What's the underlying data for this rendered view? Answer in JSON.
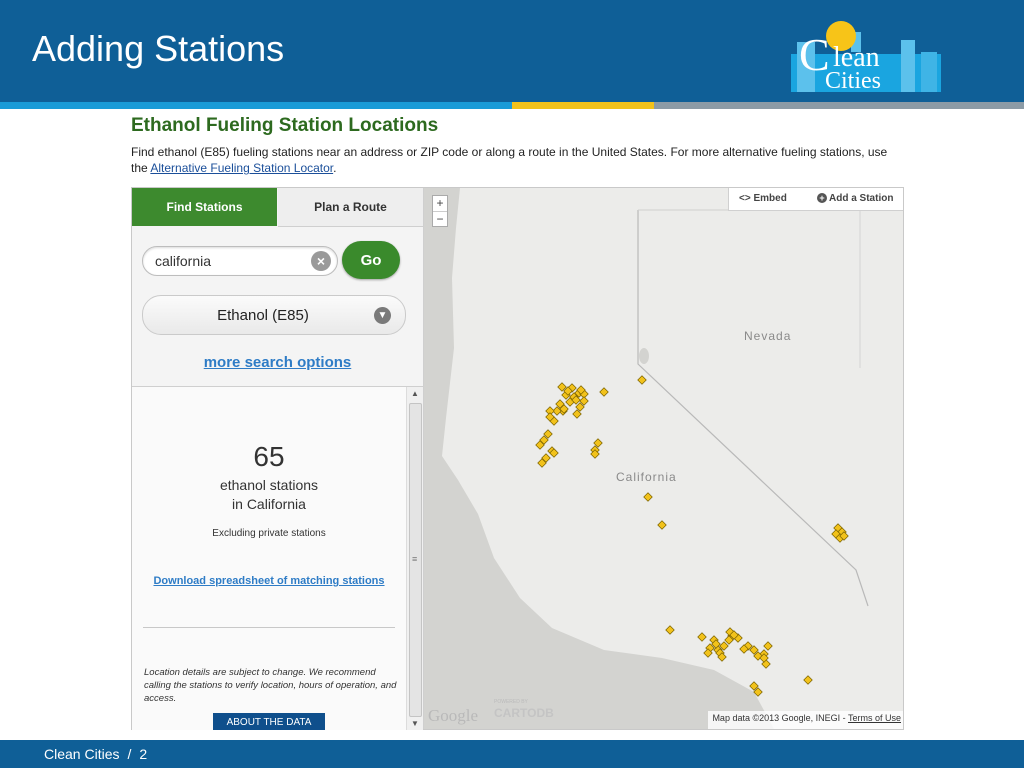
{
  "slide": {
    "title": "Adding Stations",
    "footer_text": "Clean Cities",
    "footer_sep": "/",
    "page_number": "2",
    "colors": {
      "header": "#0f5f97",
      "accent_blue": "#1a9bd7",
      "accent_yellow": "#f2c21b",
      "accent_gray": "#8c9ba6"
    }
  },
  "logo": {
    "line1": "lean",
    "initial": "C",
    "line2": "Cities"
  },
  "page": {
    "heading": "Ethanol Fueling Station Locations",
    "intro_text": "Find ethanol (E85) fueling stations near an address or ZIP code or along a route in the United States. For more alternative fueling stations, use the ",
    "intro_link": "Alternative Fueling Station Locator",
    "intro_end": "."
  },
  "panel": {
    "tabs": [
      {
        "label": "Find Stations",
        "active": true
      },
      {
        "label": "Plan a Route",
        "active": false
      }
    ],
    "search_value": "california",
    "clear_glyph": "×",
    "go_label": "Go",
    "fuel_select": "Ethanol (E85)",
    "more_options": "more search options",
    "results": {
      "count": "65",
      "line1": "ethanol stations",
      "line2": "in California",
      "excluding": "Excluding private stations",
      "download": "Download spreadsheet of matching stations",
      "disclaimer": "Location details are subject to change. We recommend calling the stations to verify location, hours of operation, and access.",
      "about_button": "ABOUT THE DATA"
    }
  },
  "map": {
    "zoom_in": "+",
    "zoom_out": "−",
    "embed_label": "<> Embed",
    "add_station_label": "Add a Station",
    "labels": {
      "nevada": "Nevada",
      "california": "California"
    },
    "google": "Google",
    "powered_by": "POWERED BY",
    "cartodb": "CARTODB",
    "attribution_text": "Map data ©2013 Google, INEGI - ",
    "terms_link": "Terms of Use",
    "marker_color": "#f2c21b"
  }
}
